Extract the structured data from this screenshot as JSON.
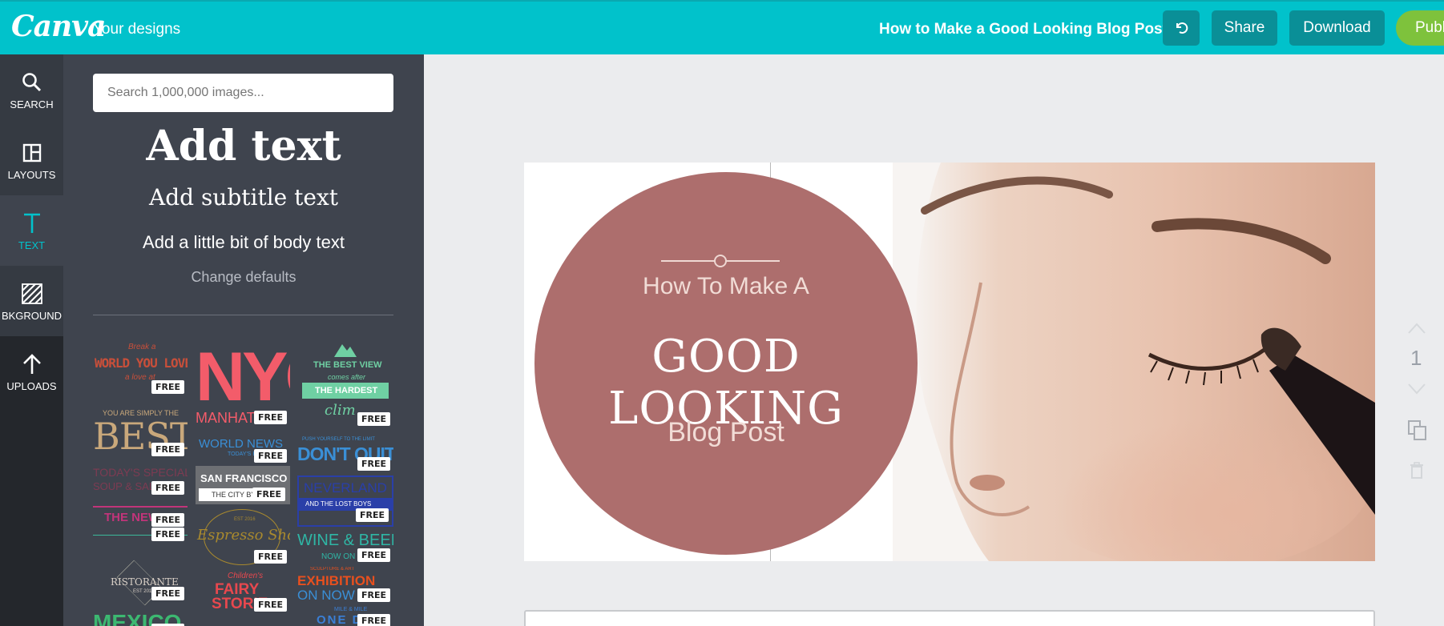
{
  "topbar": {
    "logo": "Canva",
    "your_designs": "Your designs",
    "title": "How to Make a Good Looking Blog Post",
    "share_label": "Share",
    "download_label": "Download",
    "publish_label": "Publ"
  },
  "rail": {
    "items": [
      {
        "label": "SEARCH",
        "icon": "search-icon"
      },
      {
        "label": "LAYOUTS",
        "icon": "layouts-icon"
      },
      {
        "label": "TEXT",
        "icon": "text-icon"
      },
      {
        "label": "BKGROUND",
        "icon": "background-icon"
      },
      {
        "label": "UPLOADS",
        "icon": "upload-icon"
      }
    ],
    "active": "TEXT"
  },
  "panel": {
    "search_placeholder": "Search 1,000,000 images...",
    "add_heading": "Add text",
    "add_subtitle": "Add subtitle text",
    "add_body": "Add a little bit of body text",
    "change_defaults": "Change defaults",
    "free_badge": "FREE",
    "tiles": {
      "t1_small": "Break a",
      "t1_main": "WORLD YOU LOVE",
      "t1_tail": "a love at",
      "t2_main": "NYC",
      "t2_sub": "MANHAT",
      "t3_top": "THE BEST VIEW",
      "t3_mid": "comes after",
      "t3_ribbon": "THE HARDEST",
      "t3_bot": "clim",
      "t4_top": "YOU ARE SIMPLY THE",
      "t4_main": "BEST",
      "t5_main": "WORLD NEWS",
      "t5_sub": "TODAY'S E",
      "t6_top": "PUSH YOURSELF TO THE LIMIT",
      "t6_main": "DON'T QUIT",
      "t7_main": "TODAY'S SPECIAL",
      "t7_sub": "SOUP & SALAD",
      "t8_main": "SAN FRANCISCO",
      "t8_sub": "THE CITY BY T",
      "t9_main": "NEVERLAND",
      "t9_sub": "AND THE LOST BOYS",
      "t10_main": "THE NEW",
      "t11_top": "EST 2016",
      "t11_main": "Espresso Shot",
      "t12_main": "WINE & BEER",
      "t12_sub": "NOW ON SAL",
      "t13_main": "RISTORANTE",
      "t13_sub": "EST 2016",
      "t14_top": "SCULPTURE & ART",
      "t14_main": "EXHIBITION",
      "t14_sub": "ON NOW",
      "t15_main": "MEXICO",
      "t16_top": "Children's",
      "t16_main": "FAIRY",
      "t16_sub": "STORIE",
      "t17_top": "MILE & MILE",
      "t17_main": "ONE D"
    }
  },
  "canvas": {
    "line1": "How To Make A",
    "line2": "GOOD LOOKING",
    "line3": "Blog Post",
    "circle_color": "#ad6e6d"
  },
  "page_controls": {
    "page_number": "1"
  },
  "colors": {
    "brand": "#01c2cb",
    "dark_button": "#0a8f97",
    "publish": "#7ec23c",
    "rail": "#24272c",
    "panel": "#3f444e"
  }
}
